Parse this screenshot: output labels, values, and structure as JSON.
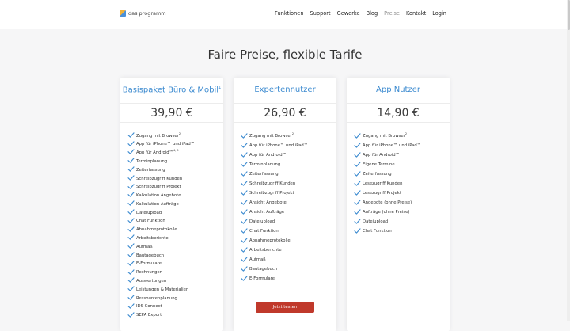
{
  "header": {
    "logo_text": "das programm",
    "nav": [
      "Funktionen",
      "Support",
      "Gewerke",
      "Blog",
      "Preise",
      "Kontakt",
      "Login"
    ]
  },
  "headline": "Faire Preise, flexible Tarife",
  "colors": {
    "accent": "#3d8bd0",
    "cta": "#c0392b",
    "check": "#3d8bd0"
  },
  "plans": [
    {
      "title": "Basispaket Büro & Mobil",
      "title_sup": "1",
      "price": "39,90 €",
      "features": [
        {
          "t": "Zugang mit Browser",
          "s": "2"
        },
        {
          "t": "App für iPhone™ und iPad™",
          "s": ""
        },
        {
          "t": "App für Android™",
          "s": "4, 5"
        },
        {
          "t": "Terminplanung",
          "s": ""
        },
        {
          "t": "Zeiterfassung",
          "s": ""
        },
        {
          "t": "Schreibzugriff Kunden",
          "s": ""
        },
        {
          "t": "Schreibzugriff Projekt",
          "s": ""
        },
        {
          "t": "Kalkulation Angebote",
          "s": ""
        },
        {
          "t": "Kalkulation Aufträge",
          "s": ""
        },
        {
          "t": "Dateiupload",
          "s": ""
        },
        {
          "t": "Chat Funktion",
          "s": ""
        },
        {
          "t": "Abnahmeprotokolle",
          "s": ""
        },
        {
          "t": "Arbeitsberichte",
          "s": ""
        },
        {
          "t": "Aufmaß",
          "s": ""
        },
        {
          "t": "Bautagebuch",
          "s": ""
        },
        {
          "t": "E-Formulare",
          "s": ""
        },
        {
          "t": "Rechnungen",
          "s": ""
        },
        {
          "t": "Auswertungen",
          "s": ""
        },
        {
          "t": "Leistungen & Materialien",
          "s": ""
        },
        {
          "t": "Ressourcenplanung",
          "s": ""
        },
        {
          "t": "IDS Connect",
          "s": ""
        },
        {
          "t": "SEPA Export",
          "s": ""
        }
      ]
    },
    {
      "title": "Expertennutzer",
      "title_sup": "",
      "price": "26,90 €",
      "features": [
        {
          "t": "Zugang mit Browser",
          "s": "2"
        },
        {
          "t": "App für iPhone™ und iPad™",
          "s": ""
        },
        {
          "t": "App für Android™",
          "s": ""
        },
        {
          "t": "Terminplanung",
          "s": ""
        },
        {
          "t": "Zeiterfassung",
          "s": ""
        },
        {
          "t": "Schreibzugriff Kunden",
          "s": ""
        },
        {
          "t": "Schreibzugriff Projekt",
          "s": ""
        },
        {
          "t": "Ansicht Angebote",
          "s": ""
        },
        {
          "t": "Ansicht Aufträge",
          "s": ""
        },
        {
          "t": "Dateiupload",
          "s": ""
        },
        {
          "t": "Chat Funktion",
          "s": ""
        },
        {
          "t": "Abnahmeprotokolle",
          "s": ""
        },
        {
          "t": "Arbeitsberichte",
          "s": ""
        },
        {
          "t": "Aufmaß",
          "s": ""
        },
        {
          "t": "Bautagebuch",
          "s": ""
        },
        {
          "t": "E-Formulare",
          "s": ""
        }
      ],
      "cta": "Jetzt testen"
    },
    {
      "title": "App Nutzer",
      "title_sup": "",
      "price": "14,90 €",
      "features": [
        {
          "t": "Zugang mit Browser",
          "s": "2"
        },
        {
          "t": "App für iPhone™ und iPad™",
          "s": ""
        },
        {
          "t": "App für Android™",
          "s": ""
        },
        {
          "t": "Eigene Termine",
          "s": ""
        },
        {
          "t": "Zeiterfassung",
          "s": ""
        },
        {
          "t": "Lesezugriff Kunden",
          "s": ""
        },
        {
          "t": "Lesezugriff Projekt",
          "s": ""
        },
        {
          "t": "Angebote (ohne Preise)",
          "s": ""
        },
        {
          "t": "Aufträge (ohne Preise)",
          "s": ""
        },
        {
          "t": "Dateiupload",
          "s": ""
        },
        {
          "t": "Chat Funktion",
          "s": ""
        }
      ]
    }
  ]
}
